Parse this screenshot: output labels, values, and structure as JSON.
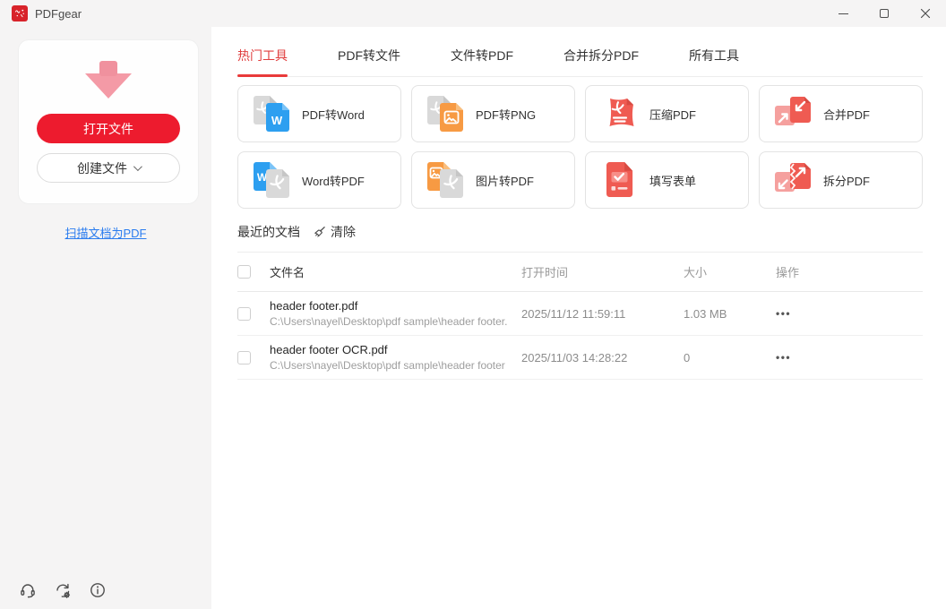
{
  "window": {
    "title": "PDFgear",
    "controls": [
      {
        "name": "minimize"
      },
      {
        "name": "maximize"
      },
      {
        "name": "close"
      }
    ]
  },
  "colors": {
    "brand_red": "#ED1B2E",
    "tab_active_red": "#E93A3A",
    "link_blue": "#2A7CEF",
    "tool_red": "#EF5B52",
    "tool_pink": "#F5A09E",
    "word_blue": "#2D9FF0",
    "image_orange": "#F79A43",
    "doc_gray": "#D9D9D9",
    "titlebar_bg": "#F5F4F4"
  },
  "sidebar": {
    "open_button_label": "打开文件",
    "create_button_label": "创建文件",
    "scan_link_label": "扫描文档为PDF",
    "footer_icons": [
      "support",
      "check-update",
      "about"
    ]
  },
  "tabs": [
    {
      "label": "热门工具",
      "active": true
    },
    {
      "label": "PDF转文件",
      "active": false
    },
    {
      "label": "文件转PDF",
      "active": false
    },
    {
      "label": "合并拆分PDF",
      "active": false
    },
    {
      "label": "所有工具",
      "active": false
    }
  ],
  "tools": [
    {
      "label": "PDF转Word",
      "icon": "pdf-to-word"
    },
    {
      "label": "PDF转PNG",
      "icon": "pdf-to-png"
    },
    {
      "label": "压缩PDF",
      "icon": "compress-pdf"
    },
    {
      "label": "合并PDF",
      "icon": "merge-pdf"
    },
    {
      "label": "Word转PDF",
      "icon": "word-to-pdf"
    },
    {
      "label": "图片转PDF",
      "icon": "image-to-pdf"
    },
    {
      "label": "填写表单",
      "icon": "fill-form"
    },
    {
      "label": "拆分PDF",
      "icon": "split-pdf"
    }
  ],
  "recent": {
    "title": "最近的文档",
    "clear_label": "清除",
    "more_icon": "•••",
    "columns": {
      "name": "文件名",
      "time": "打开时间",
      "size": "大小",
      "action": "操作"
    },
    "rows": [
      {
        "name": "header footer.pdf",
        "path": "C:\\Users\\nayel\\Desktop\\pdf sample\\header footer.",
        "time": "2025/11/12 11:59:11",
        "size": "1.03 MB"
      },
      {
        "name": "header footer OCR.pdf",
        "path": "C:\\Users\\nayel\\Desktop\\pdf sample\\header footer",
        "time": "2025/11/03 14:28:22",
        "size": "0"
      }
    ]
  }
}
